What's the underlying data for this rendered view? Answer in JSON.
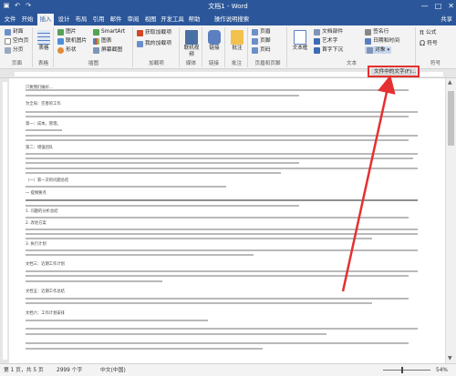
{
  "window": {
    "title": "文档1 - Word",
    "minimize_glyph": "—",
    "maximize_glyph": "□",
    "close_glyph": "✕"
  },
  "tabs": {
    "items": [
      "文件",
      "开始",
      "插入",
      "设计",
      "布局",
      "引用",
      "邮件",
      "审阅",
      "视图",
      "开发工具",
      "帮助",
      "操作说明搜索"
    ],
    "active": "插入",
    "share": "共享"
  },
  "ribbon": {
    "pages_group": {
      "items": [
        "封面",
        "空白页",
        "分页"
      ],
      "label": "页面"
    },
    "table_group": {
      "button": "表格",
      "label": "表格"
    },
    "illustrations_group": {
      "items": [
        "图片",
        "联机图片",
        "形状"
      ],
      "items2": [
        "SmartArt",
        "图表",
        "屏幕截图"
      ],
      "label": "插图"
    },
    "addins_group": {
      "items": [
        "获取加载项",
        "我的加载项"
      ],
      "label": "加载项"
    },
    "media_group": {
      "button": "联机视频",
      "label": "媒体"
    },
    "links_group": {
      "button": "链接",
      "label": "链接"
    },
    "comments_group": {
      "button": "批注",
      "label": "批注"
    },
    "header_footer_group": {
      "items": [
        "页眉",
        "页脚",
        "页码"
      ],
      "label": "页眉和页脚"
    },
    "text_group": {
      "button": "文本框",
      "items": [
        "文档部件",
        "艺术字",
        "首字下沉"
      ],
      "items2": [
        "签名行",
        "日期和时间",
        "对象"
      ],
      "label": "文本"
    },
    "symbols_group": {
      "items": [
        "公式",
        "符号"
      ],
      "label": "符号"
    }
  },
  "highlight_button": {
    "label": "文件中的文字(F)..."
  },
  "document": {
    "lines": [
      "只要我们做好...",
      "为全局：完善的工作",
      "我们要把为此做的一些事情,上个月团队已经在为我们在...",
      "第一：成本。管理。",
      "第二：增强团队",
      "（一）第一次的问题总结",
      "一 提纲要点",
      "1. 问题的分析总结",
      "2. 改进方案",
      "3. 执行计划",
      "文档三：近期工作计划",
      "文档五：近期工作总结",
      "文档六：工作计划安排"
    ]
  },
  "statusbar": {
    "page": "第 1 页，共 5 页",
    "words": "2999 个字",
    "lang": "中文(中国)",
    "zoom": "54%"
  },
  "colors": {
    "titlebar": "#2b579a",
    "highlight_border": "#e53030",
    "arrow": "#e53030"
  }
}
